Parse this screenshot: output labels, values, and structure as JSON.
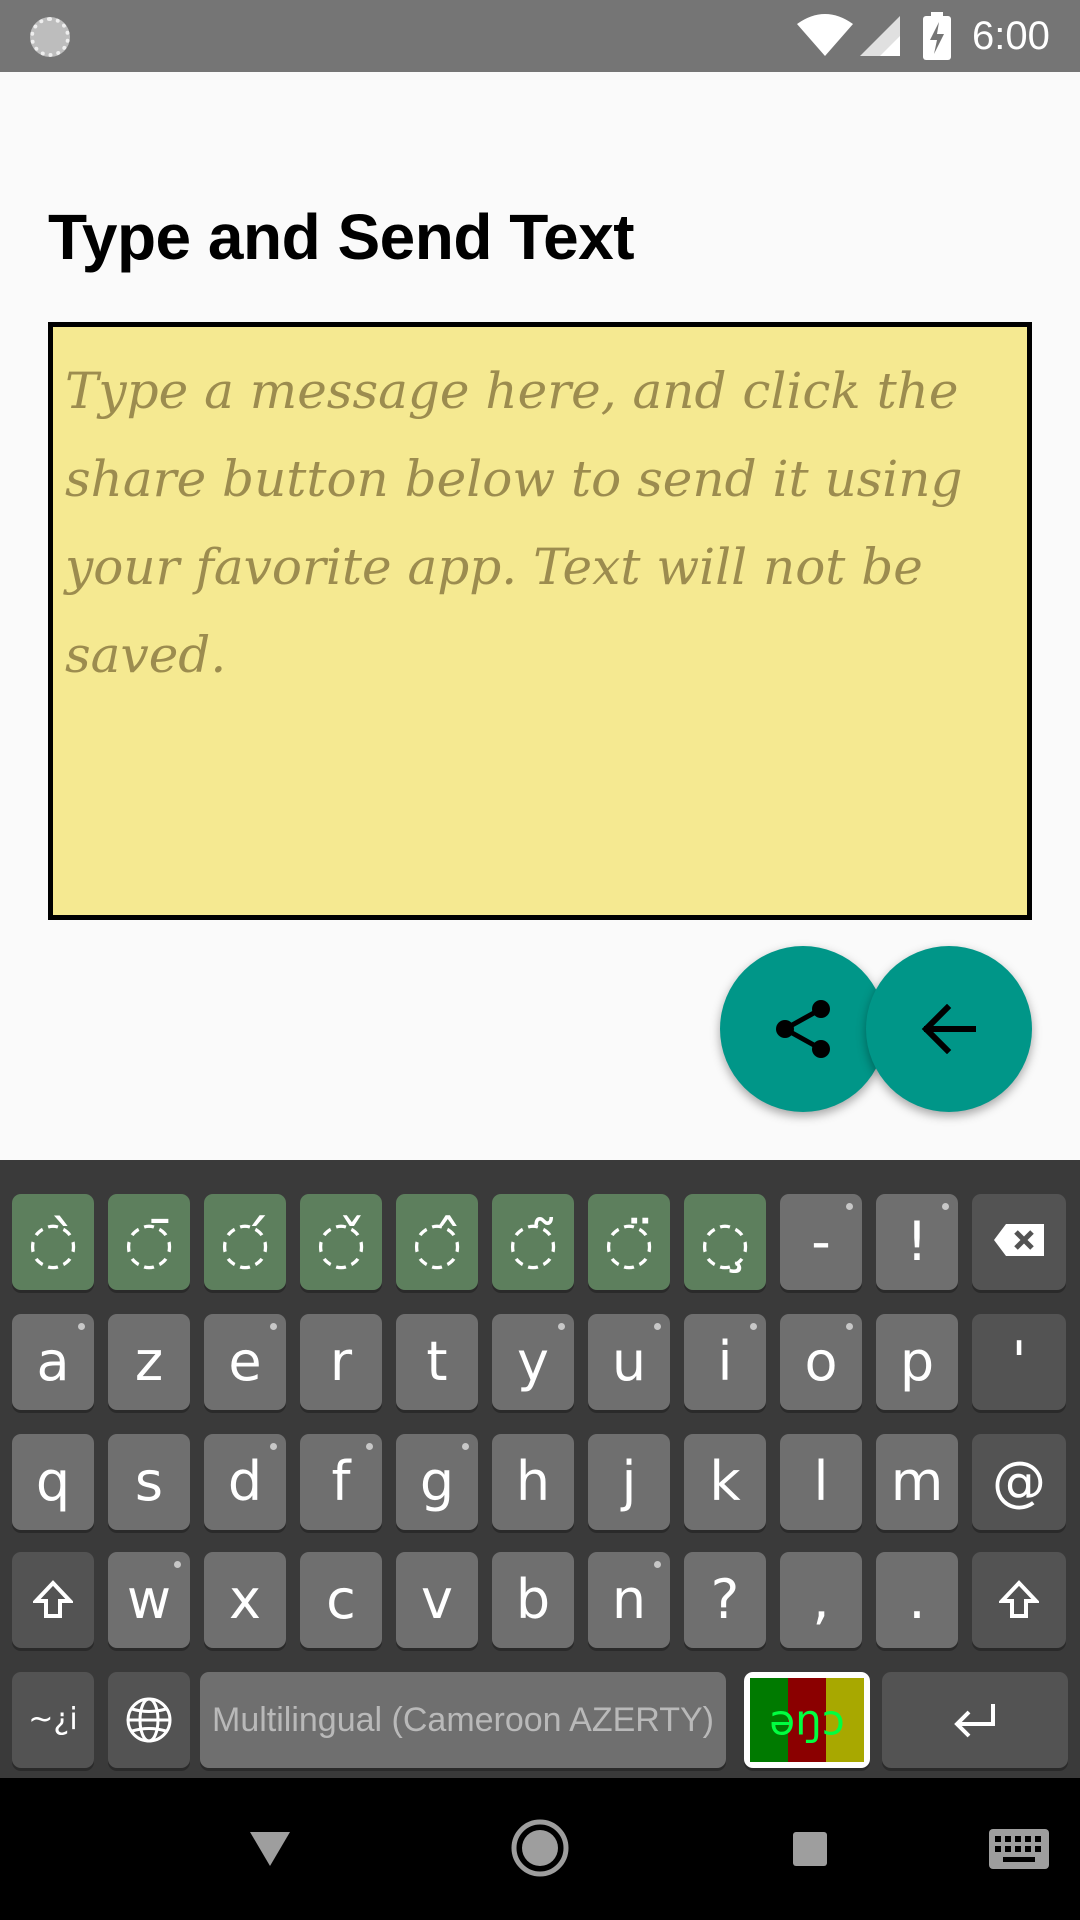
{
  "status_bar": {
    "time": "6:00"
  },
  "app": {
    "title": "Type and Send Text",
    "message_placeholder": "Type a message here, and click the share button below to send it using your favorite app. Text will not be saved.",
    "share_icon": "share-icon",
    "back_icon": "arrow-left-icon"
  },
  "keyboard": {
    "row1": [
      "̀",
      "̄",
      "́",
      "̌",
      "̂",
      "̃",
      "̈",
      "̧",
      "-",
      "!"
    ],
    "row1_base": "◌",
    "row2": [
      "a",
      "z",
      "e",
      "r",
      "t",
      "y",
      "u",
      "i",
      "o",
      "p",
      "'"
    ],
    "row3": [
      "q",
      "s",
      "d",
      "f",
      "g",
      "h",
      "j",
      "k",
      "l",
      "m",
      "@"
    ],
    "row4": [
      "w",
      "x",
      "c",
      "v",
      "b",
      "n",
      "?",
      ",",
      "."
    ],
    "symbols_key": "~¿i",
    "space_label": "Multilingual (Cameroon AZERTY)",
    "language_key_text": "əŋɔ",
    "flag_colors": [
      "#007a00",
      "#8b0000",
      "#a8a800"
    ]
  },
  "colors": {
    "accent": "#009688",
    "message_background": "#f5e991",
    "status_bar": "#757575"
  }
}
